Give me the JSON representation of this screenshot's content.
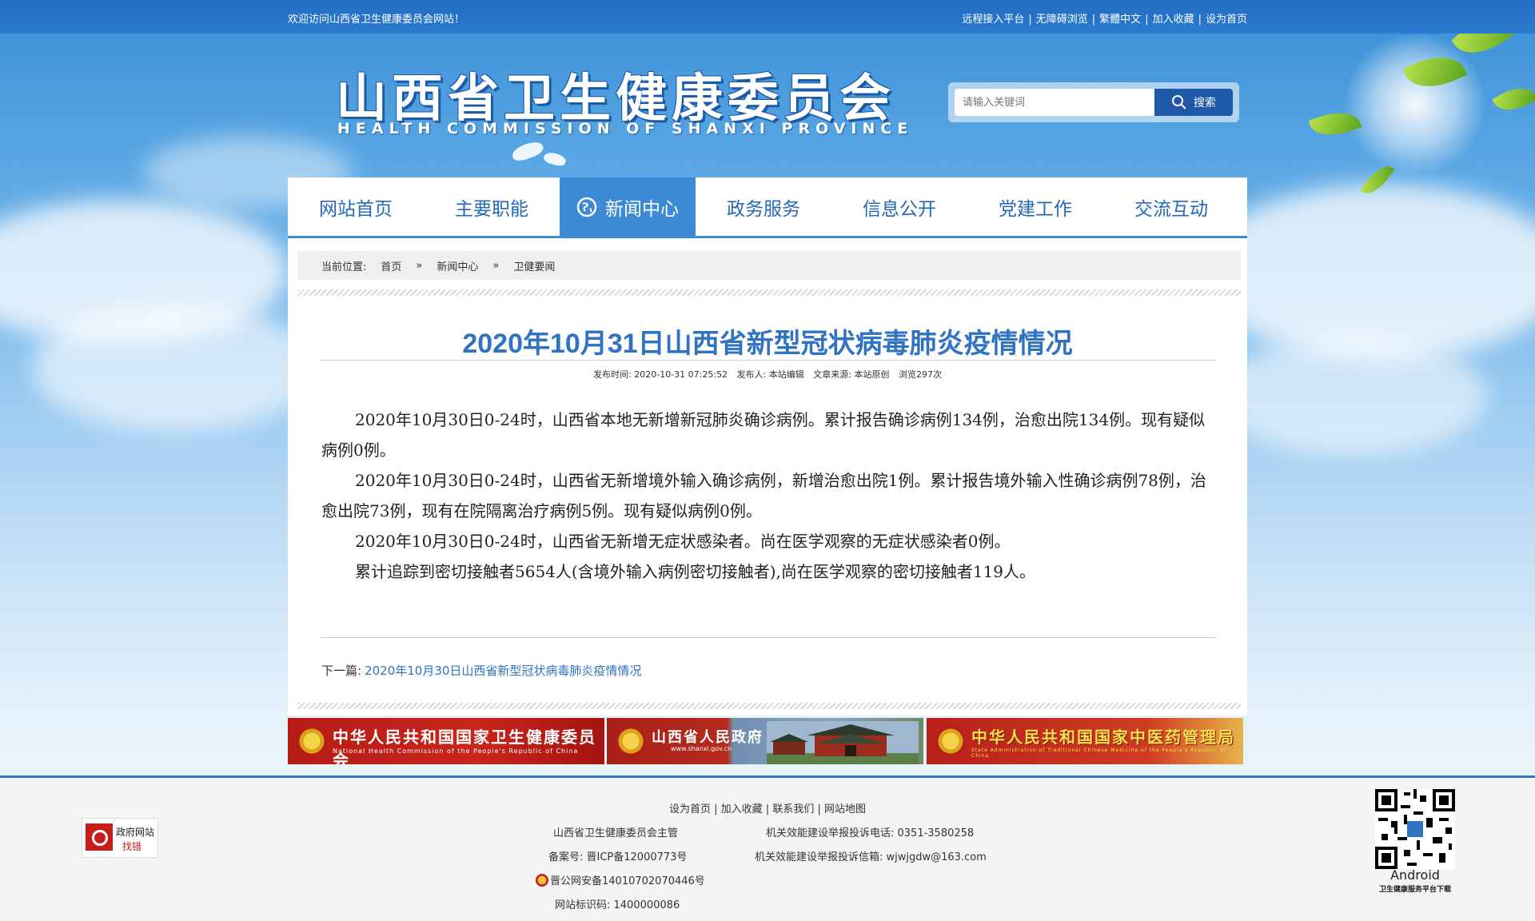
{
  "topbar": {
    "welcome": "欢迎访问山西省卫生健康委员会网站！",
    "links": [
      "远程接入平台",
      "无障碍浏览",
      "繁體中文",
      "加入收藏",
      "设为首页"
    ]
  },
  "header": {
    "title_cn": "山西省卫生健康委员会",
    "title_en": "HEALTH COMMISSION OF SHANXI PROVINCE"
  },
  "search": {
    "placeholder": "请输入关键词",
    "button": "搜索"
  },
  "nav": {
    "items": [
      "网站首页",
      "主要职能",
      "新闻中心",
      "政务服务",
      "信息公开",
      "党建工作",
      "交流互动"
    ],
    "active_index": 2
  },
  "breadcrumb": {
    "label": "当前位置:",
    "items": [
      "首页",
      "新闻中心",
      "卫健要闻"
    ],
    "separator": "»"
  },
  "article": {
    "title": "2020年10月31日山西省新型冠状病毒肺炎疫情情况",
    "meta": {
      "publish_time": "发布时间: 2020-10-31 07:25:52",
      "publisher": "发布人: 本站编辑",
      "source": "文章来源: 本站原创",
      "views": "浏览297次"
    },
    "paragraphs": [
      "2020年10月30日0-24时，山西省本地无新增新冠肺炎确诊病例。累计报告确诊病例134例，治愈出院134例。现有疑似病例0例。",
      "2020年10月30日0-24时，山西省无新增境外输入确诊病例，新增治愈出院1例。累计报告境外输入性确诊病例78例，治愈出院73例，现有在院隔离治疗病例5例。现有疑似病例0例。",
      "2020年10月30日0-24时，山西省无新增无症状感染者。尚在医学观察的无症状感染者0例。",
      "累计追踪到密切接触者5654人(含境外输入病例密切接触者),尚在医学观察的密切接触者119人。"
    ],
    "next_label": "下一篇:",
    "next_link": "2020年10月30日山西省新型冠状病毒肺炎疫情情况"
  },
  "banners": [
    {
      "title": "中华人民共和国国家卫生健康委员会",
      "subtitle": "National Health Commission of the People's Republic of China"
    },
    {
      "title": "山西省人民政府",
      "subtitle": "www.shanxi.gov.cn"
    },
    {
      "title": "中华人民共和国国家中医药管理局",
      "subtitle": "State Administration of Traditional Chinese Medicine of the People's Republic of China"
    }
  ],
  "footer": {
    "links": [
      "设为首页",
      "加入收藏",
      "联系我们",
      "网站地图"
    ],
    "sponsor": "山西省卫生健康委员会主管",
    "icp": "备案号: 晋ICP备12000773号",
    "police": "晋公网安备14010702070446号",
    "site_id": "网站标识码: 1400000086",
    "complaint_phone": "机关效能建设举报投诉电话: 0351-3580258",
    "complaint_email": "机关效能建设举报投诉信箱: wjwjgdw@163.com",
    "gov_badge_line1": "政府网站",
    "gov_badge_line2": "找错",
    "qr_label": "Android",
    "qr_caption": "卫生健康服务平台下载"
  },
  "colors": {
    "accent": "#2f73c2",
    "nav_active": "#3d8ad6",
    "topbar": "#2471c4"
  }
}
